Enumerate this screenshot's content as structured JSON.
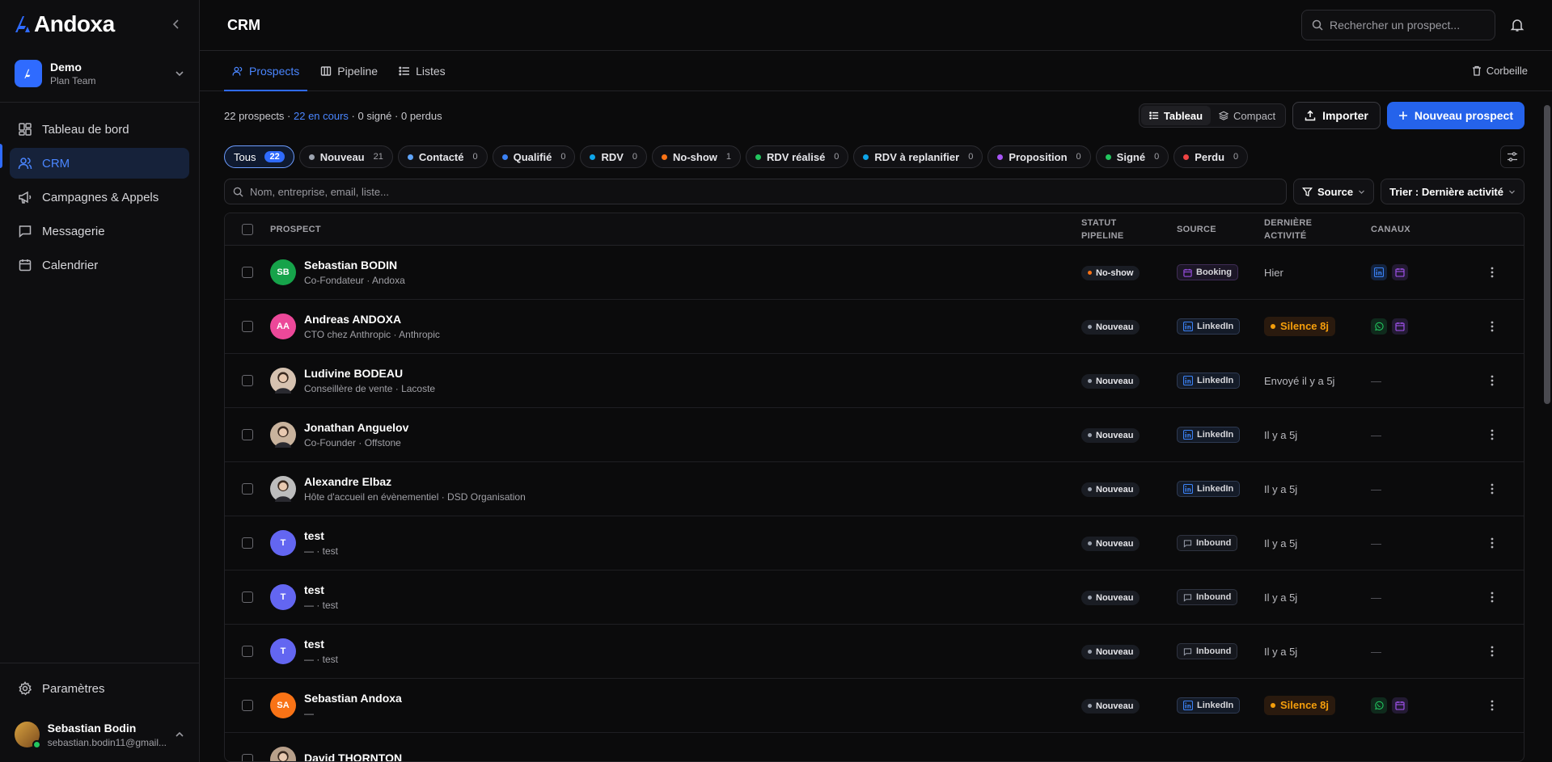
{
  "brand": {
    "name": "Andoxa"
  },
  "workspace": {
    "name": "Demo",
    "plan": "Plan Team"
  },
  "nav": [
    {
      "label": "Tableau de bord",
      "icon": "dashboard-icon"
    },
    {
      "label": "CRM",
      "icon": "users-icon"
    },
    {
      "label": "Campagnes & Appels",
      "icon": "megaphone-icon"
    },
    {
      "label": "Messagerie",
      "icon": "message-icon"
    },
    {
      "label": "Calendrier",
      "icon": "calendar-icon"
    }
  ],
  "settings_label": "Paramètres",
  "user": {
    "name": "Sebastian Bodin",
    "email": "sebastian.bodin11@gmail..."
  },
  "header": {
    "title": "CRM",
    "search_placeholder": "Rechercher un prospect..."
  },
  "tabs": [
    {
      "label": "Prospects",
      "active": true
    },
    {
      "label": "Pipeline",
      "active": false
    },
    {
      "label": "Listes",
      "active": false
    }
  ],
  "trash_label": "Corbeille",
  "stats": {
    "total": "22 prospects",
    "sep1": " · ",
    "en_cours": "22 en cours",
    "signes": " · 0 signé",
    "perdus": " · 0 perdus"
  },
  "view_toggle": {
    "table": "Tableau",
    "compact": "Compact"
  },
  "buttons": {
    "import": "Importer",
    "new": "Nouveau prospect"
  },
  "chips": [
    {
      "label": "Tous",
      "count": "22",
      "color": ""
    },
    {
      "label": "Nouveau",
      "count": "21",
      "color": "#9ca3af"
    },
    {
      "label": "Contacté",
      "count": "0",
      "color": "#60a5fa"
    },
    {
      "label": "Qualifié",
      "count": "0",
      "color": "#3b82f6"
    },
    {
      "label": "RDV",
      "count": "0",
      "color": "#0ea5e9"
    },
    {
      "label": "No-show",
      "count": "1",
      "color": "#f97316"
    },
    {
      "label": "RDV réalisé",
      "count": "0",
      "color": "#22c55e"
    },
    {
      "label": "RDV à replanifier",
      "count": "0",
      "color": "#0ea5e9"
    },
    {
      "label": "Proposition",
      "count": "0",
      "color": "#a855f7"
    },
    {
      "label": "Signé",
      "count": "0",
      "color": "#22c55e"
    },
    {
      "label": "Perdu",
      "count": "0",
      "color": "#ef4444"
    }
  ],
  "search_placeholder": "Nom, entreprise, email, liste...",
  "source_filter_label": "Source",
  "sort_label": "Trier : Dernière activité",
  "table": {
    "headers": {
      "prospect": "PROSPECT",
      "statut_1": "STATUT",
      "statut_2": "PIPELINE",
      "source": "SOURCE",
      "activite_1": "DERNIÈRE",
      "activite_2": "ACTIVITÉ",
      "canaux": "CANAUX"
    },
    "rows": [
      {
        "initials": "SB",
        "avatar_color": "#16a34a",
        "photo": false,
        "name": "Sebastian BODIN",
        "sub": "Co-Fondateur · Andoxa",
        "status": "No-show",
        "status_color": "#f97316",
        "source": "Booking",
        "activity": "Hier",
        "silence": false,
        "channels": [
          "linkedin",
          "calendar"
        ]
      },
      {
        "initials": "AA",
        "avatar_color": "#ec4899",
        "photo": false,
        "name": "Andreas ANDOXA",
        "sub": "CTO chez Anthropic · Anthropic",
        "status": "Nouveau",
        "status_color": "#9ca3af",
        "source": "LinkedIn",
        "activity": "Silence 8j",
        "silence": true,
        "channels": [
          "whatsapp",
          "calendar"
        ]
      },
      {
        "initials": "",
        "avatar_color": "#d6c2b0",
        "photo": true,
        "name": "Ludivine BODEAU",
        "sub": "Conseillère de vente · Lacoste",
        "status": "Nouveau",
        "status_color": "#9ca3af",
        "source": "LinkedIn",
        "activity": "Envoyé il y a 5j",
        "silence": false,
        "channels": []
      },
      {
        "initials": "",
        "avatar_color": "#c9b39d",
        "photo": true,
        "name": "Jonathan Anguelov",
        "sub": "Co-Founder · Offstone",
        "status": "Nouveau",
        "status_color": "#9ca3af",
        "source": "LinkedIn",
        "activity": "Il y a 5j",
        "silence": false,
        "channels": []
      },
      {
        "initials": "",
        "avatar_color": "#bdbdbd",
        "photo": true,
        "name": "Alexandre Elbaz",
        "sub": "Hôte d'accueil en évènementiel · DSD Organisation",
        "status": "Nouveau",
        "status_color": "#9ca3af",
        "source": "LinkedIn",
        "activity": "Il y a 5j",
        "silence": false,
        "channels": []
      },
      {
        "initials": "T",
        "avatar_color": "#6366f1",
        "photo": false,
        "name": "test",
        "sub": "— · test",
        "status": "Nouveau",
        "status_color": "#9ca3af",
        "source": "Inbound",
        "activity": "Il y a 5j",
        "silence": false,
        "channels": []
      },
      {
        "initials": "T",
        "avatar_color": "#6366f1",
        "photo": false,
        "name": "test",
        "sub": "— · test",
        "status": "Nouveau",
        "status_color": "#9ca3af",
        "source": "Inbound",
        "activity": "Il y a 5j",
        "silence": false,
        "channels": []
      },
      {
        "initials": "T",
        "avatar_color": "#6366f1",
        "photo": false,
        "name": "test",
        "sub": "— · test",
        "status": "Nouveau",
        "status_color": "#9ca3af",
        "source": "Inbound",
        "activity": "Il y a 5j",
        "silence": false,
        "channels": []
      },
      {
        "initials": "SA",
        "avatar_color": "#f97316",
        "photo": false,
        "name": "Sebastian Andoxa",
        "sub": "—",
        "status": "Nouveau",
        "status_color": "#9ca3af",
        "source": "LinkedIn",
        "activity": "Silence 8j",
        "silence": true,
        "channels": [
          "whatsapp",
          "calendar"
        ]
      },
      {
        "initials": "",
        "avatar_color": "#b8a08a",
        "photo": true,
        "name": "David THORNTON",
        "sub": "",
        "status": "",
        "status_color": "#9ca3af",
        "source": "",
        "activity": "",
        "silence": false,
        "channels": []
      }
    ],
    "empty_channel": "—"
  },
  "colors": {
    "accent": "#2f6bff",
    "background": "#0b0b0c",
    "warning": "#f59e0b"
  }
}
